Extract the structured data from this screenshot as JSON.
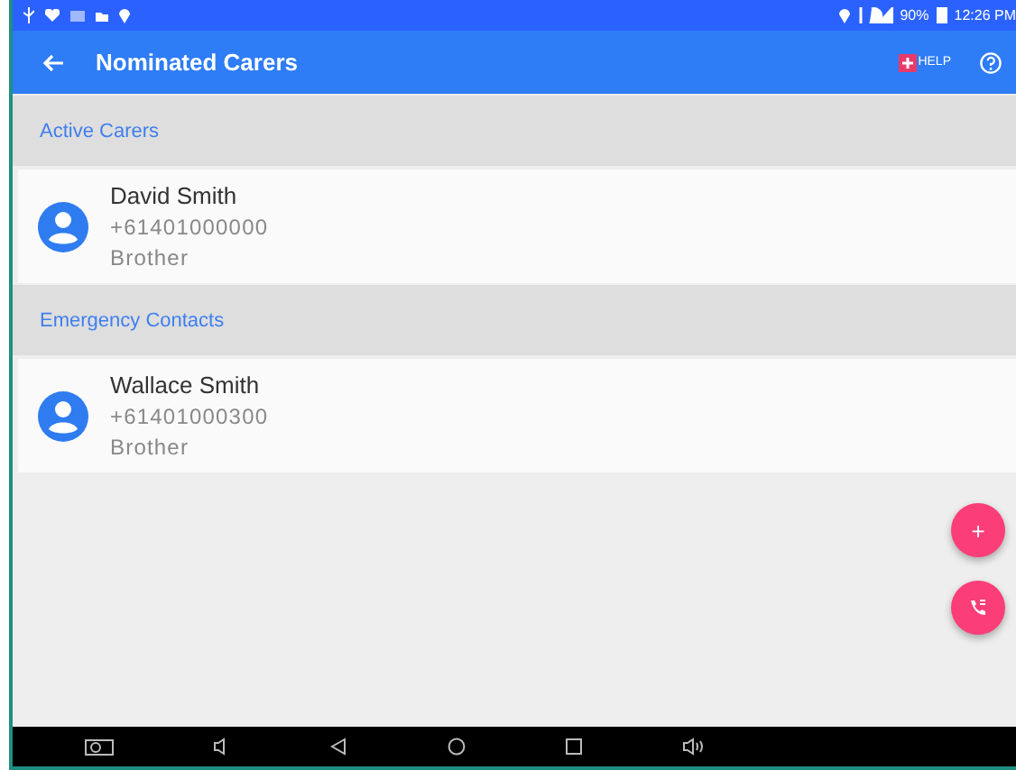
{
  "status_bar": {
    "battery": "90%",
    "time": "12:26 PM"
  },
  "app_bar": {
    "title": "Nominated Carers",
    "help": "HELP"
  },
  "sections": [
    {
      "title": "Active Carers",
      "contacts": [
        {
          "name": "David Smith",
          "phone": "+61401000000",
          "relation": "Brother"
        }
      ]
    },
    {
      "title": "Emergency Contacts",
      "contacts": [
        {
          "name": "Wallace Smith",
          "phone": "+61401000300",
          "relation": "Brother"
        }
      ]
    }
  ],
  "fabs": [
    {
      "kind": "add",
      "label": "+"
    },
    {
      "kind": "call"
    }
  ]
}
